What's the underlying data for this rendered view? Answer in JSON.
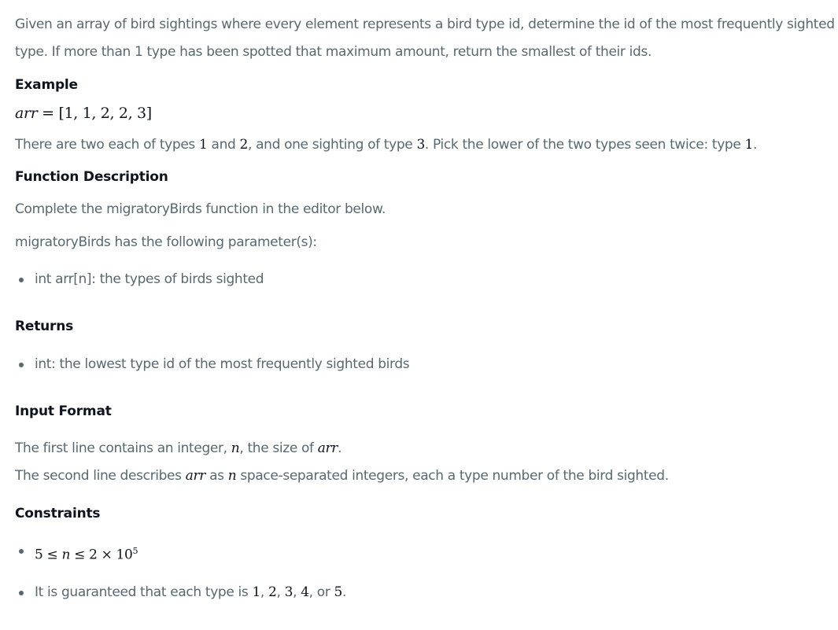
{
  "intro": {
    "line1": "Given an array of bird sightings where every element represents a bird type id, determine the id of the most frequently sighted",
    "line2": "type. If more than 1 type has been spotted that maximum amount, return the smallest of their ids."
  },
  "example": {
    "heading": "Example",
    "var": "arr",
    "eq": "=",
    "value": "[1, 1, 2, 2, 3]",
    "explain_a": "There are two each of types ",
    "explain_n1": "1",
    "explain_b": " and ",
    "explain_n2": "2",
    "explain_c": ", and one sighting of type ",
    "explain_n3": "3",
    "explain_d": ". Pick the lower of the two types seen twice: type ",
    "explain_n4": "1",
    "explain_e": "."
  },
  "function_description": {
    "heading": "Function Description",
    "line1": "Complete the migratoryBirds function in the editor below.",
    "line2": "migratoryBirds has the following parameter(s):",
    "params": [
      "int arr[n]: the types of birds sighted"
    ]
  },
  "returns": {
    "heading": "Returns",
    "items": [
      "int: the lowest type id of the most frequently sighted birds"
    ]
  },
  "input_format": {
    "heading": "Input Format",
    "line1_a": "The first line contains an integer, ",
    "line1_n": "n",
    "line1_b": ", the size of ",
    "line1_arr": "arr",
    "line1_c": ".",
    "line2_a": "The second line describes ",
    "line2_arr": "arr",
    "line2_b": " as ",
    "line2_n": "n",
    "line2_c": " space-separated integers, each a type number of the bird sighted."
  },
  "constraints": {
    "heading": "Constraints",
    "c1_a": "5 ≤ ",
    "c1_n": "n",
    "c1_b": " ≤ 2 × 10",
    "c1_exp": "5",
    "c2_a": "It is guaranteed that each type is ",
    "c2_1": "1",
    "c2_s1": ", ",
    "c2_2": "2",
    "c2_s2": ", ",
    "c2_3": "3",
    "c2_s3": ", ",
    "c2_4": "4",
    "c2_s4": ", or ",
    "c2_5": "5",
    "c2_end": "."
  }
}
